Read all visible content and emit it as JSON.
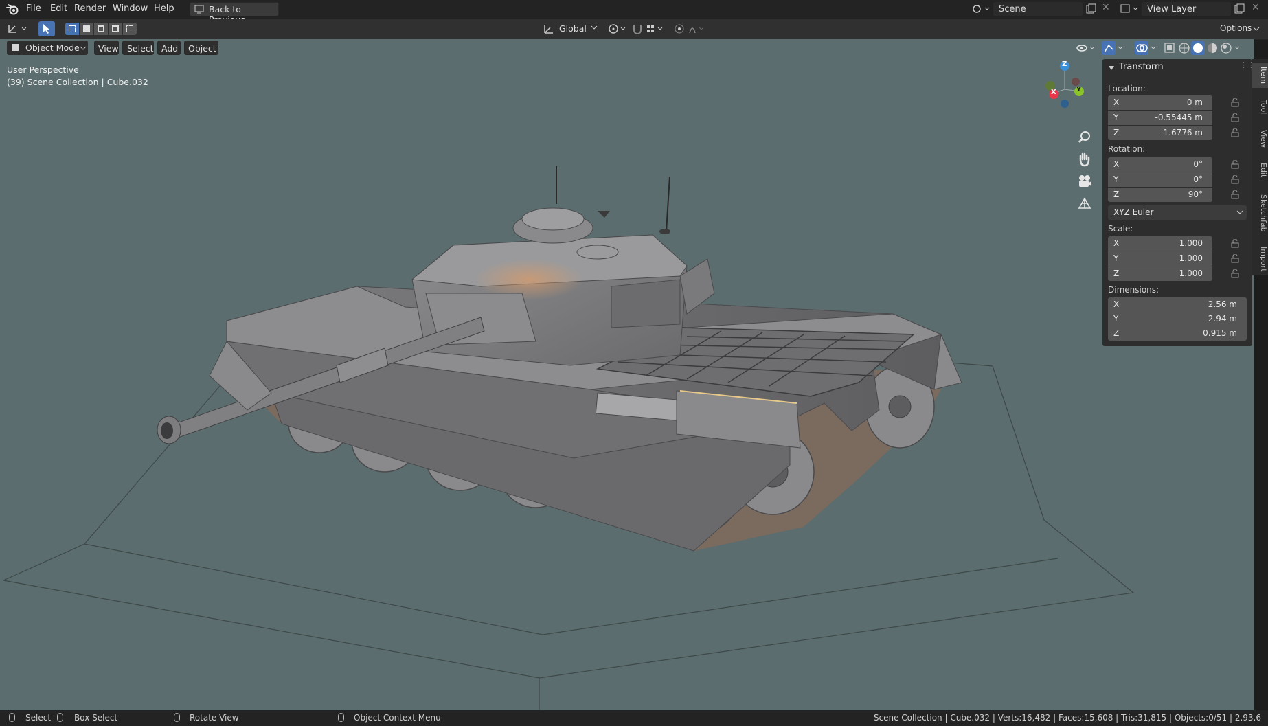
{
  "menu": {
    "items": [
      "File",
      "Edit",
      "Render",
      "Window",
      "Help"
    ],
    "back_button": "Back to Previous",
    "scene_name": "Scene",
    "view_layer": "View Layer"
  },
  "header": {
    "transform_orientation": "Global",
    "options_label": "Options",
    "mode": "Object Mode",
    "view_menu": [
      "View",
      "Select",
      "Add",
      "Object"
    ]
  },
  "viewport": {
    "perspective": "User Perspective",
    "collection_info": "(39) Scene Collection | Cube.032",
    "gizmo": {
      "x": "X",
      "y": "Y",
      "z": "Z"
    }
  },
  "npanel": {
    "title": "Transform",
    "location_label": "Location:",
    "location": [
      {
        "axis": "X",
        "value": "0 m"
      },
      {
        "axis": "Y",
        "value": "-0.55445 m"
      },
      {
        "axis": "Z",
        "value": "1.6776 m"
      }
    ],
    "rotation_label": "Rotation:",
    "rotation": [
      {
        "axis": "X",
        "value": "0°"
      },
      {
        "axis": "Y",
        "value": "0°"
      },
      {
        "axis": "Z",
        "value": "90°"
      }
    ],
    "rotation_mode": "XYZ Euler",
    "scale_label": "Scale:",
    "scale": [
      {
        "axis": "X",
        "value": "1.000"
      },
      {
        "axis": "Y",
        "value": "1.000"
      },
      {
        "axis": "Z",
        "value": "1.000"
      }
    ],
    "dimensions_label": "Dimensions:",
    "dimensions": [
      {
        "axis": "X",
        "value": "2.56 m"
      },
      {
        "axis": "Y",
        "value": "2.94 m"
      },
      {
        "axis": "Z",
        "value": "0.915 m"
      }
    ]
  },
  "sidebar_tabs": [
    "Item",
    "Tool",
    "View",
    "Edit",
    "Sketchfab",
    "Import"
  ],
  "statusbar": {
    "select": "Select",
    "box_select": "Box Select",
    "rotate_view": "Rotate View",
    "context_menu": "Object Context Menu",
    "stats": "Scene Collection | Cube.032 | Verts:16,482 | Faces:15,608 | Tris:31,815 | Objects:0/51 | 2.93.6"
  },
  "colors": {
    "viewport_bg": "#5b6d6f",
    "accent_blue": "#4772b3",
    "axis_x": "#e8364a",
    "axis_y": "#8bc42a",
    "axis_z": "#3a8fd9"
  }
}
